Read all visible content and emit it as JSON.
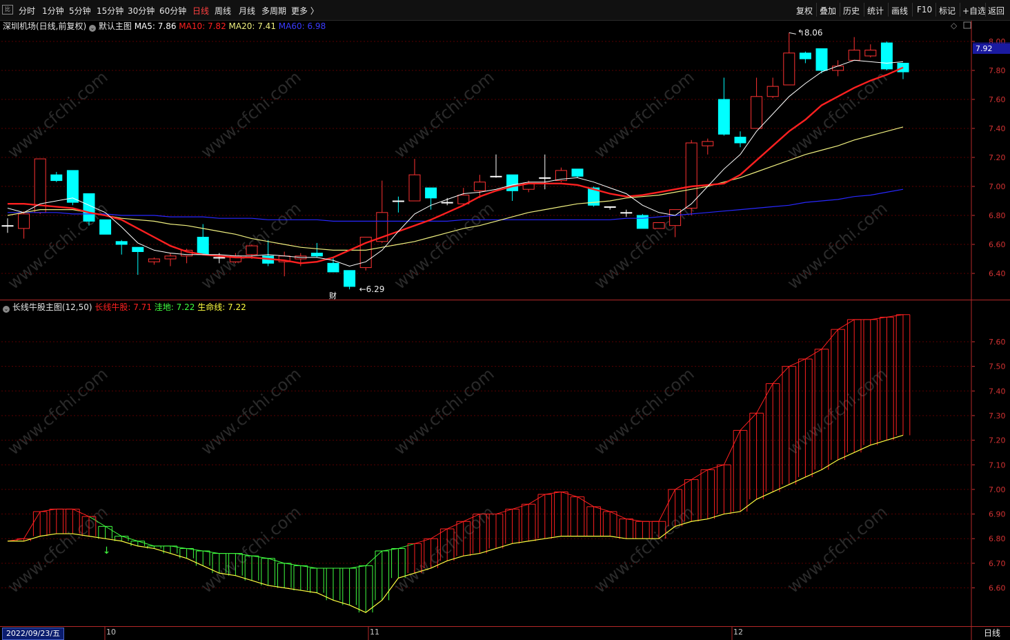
{
  "toolbar": {
    "logo": "比",
    "periods": [
      "分时",
      "1分钟",
      "5分钟",
      "15分钟",
      "30分钟",
      "60分钟",
      "日线",
      "周线",
      "月线",
      "多周期",
      "更多 〉"
    ],
    "active_period": "日线",
    "tools": [
      "复权",
      "叠加",
      "历史",
      "统计",
      "画线",
      "F10",
      "标记",
      "+自选",
      "返回"
    ]
  },
  "main_panel": {
    "stock_title": "深圳机场(日线,前复权)",
    "template_name": "默认主图",
    "ma5": "MA5: 7.86",
    "ma10": "MA10: 7.82",
    "ma20": "MA20: 7.41",
    "ma60": "MA60: 6.98",
    "high_marker": "8.06",
    "low_marker": "6.29",
    "event_marker": "财",
    "current_price": "7.92",
    "price_ticks": [
      "8.00",
      "7.80",
      "7.60",
      "7.40",
      "7.20",
      "7.00",
      "6.80",
      "6.60",
      "6.40"
    ],
    "colors": {
      "up": "#ff3232",
      "down": "#00ffff",
      "ma5": "#ffffff",
      "ma10": "#ff2020",
      "ma20": "#f0f080",
      "ma60": "#2828ff"
    }
  },
  "indicator_panel": {
    "name": "长线牛股主图(12,50)",
    "line1": "长线牛股: 7.71",
    "line2": "洼地: 7.22",
    "line3": "生命线: 7.22",
    "price_ticks": [
      "7.60",
      "7.50",
      "7.40",
      "7.30",
      "7.20",
      "7.10",
      "7.00",
      "6.90",
      "6.80",
      "6.70",
      "6.60"
    ],
    "colors": {
      "bull": "#ff2020",
      "dip": "#40ff40",
      "life": "#ffff40"
    }
  },
  "footer": {
    "date": "2022/09/23/五",
    "months": [
      "10",
      "11",
      "12"
    ],
    "period_label": "日线"
  },
  "watermark": "www.cfchi.com",
  "chart_data": {
    "type": "candlestick",
    "candles": [
      [
        6.73,
        6.73,
        6.78,
        6.68
      ],
      [
        6.71,
        6.81,
        6.83,
        6.64
      ],
      [
        6.82,
        7.19,
        7.19,
        6.81
      ],
      [
        7.08,
        7.04,
        7.1,
        7.03
      ],
      [
        7.11,
        6.89,
        7.11,
        6.87
      ],
      [
        6.95,
        6.76,
        6.95,
        6.73
      ],
      [
        6.77,
        6.67,
        6.77,
        6.67
      ],
      [
        6.62,
        6.6,
        6.63,
        6.53
      ],
      [
        6.58,
        6.55,
        6.58,
        6.39
      ],
      [
        6.48,
        6.5,
        6.51,
        6.46
      ],
      [
        6.5,
        6.52,
        6.54,
        6.45
      ],
      [
        6.52,
        6.56,
        6.57,
        6.47
      ],
      [
        6.65,
        6.53,
        6.74,
        6.53
      ],
      [
        6.51,
        6.51,
        6.54,
        6.47
      ],
      [
        6.48,
        6.52,
        6.54,
        6.47
      ],
      [
        6.53,
        6.59,
        6.6,
        6.5
      ],
      [
        6.52,
        6.47,
        6.63,
        6.45
      ],
      [
        6.48,
        6.52,
        6.55,
        6.38
      ],
      [
        6.5,
        6.52,
        6.54,
        6.45
      ],
      [
        6.54,
        6.52,
        6.61,
        6.51
      ],
      [
        6.47,
        6.41,
        6.51,
        6.41
      ],
      [
        6.42,
        6.31,
        6.42,
        6.29
      ],
      [
        6.44,
        6.65,
        6.65,
        6.42
      ],
      [
        6.62,
        6.82,
        7.04,
        6.61
      ],
      [
        6.9,
        6.89,
        6.93,
        6.82
      ],
      [
        6.9,
        7.08,
        7.19,
        6.9
      ],
      [
        6.99,
        6.92,
        6.99,
        6.84
      ],
      [
        6.88,
        6.89,
        6.92,
        6.87
      ],
      [
        6.88,
        6.94,
        6.99,
        6.87
      ],
      [
        6.97,
        7.03,
        7.08,
        6.92
      ],
      [
        7.07,
        7.07,
        7.22,
        7.06
      ],
      [
        7.08,
        6.97,
        7.08,
        6.9
      ],
      [
        6.98,
        7.02,
        7.04,
        6.96
      ],
      [
        7.05,
        7.06,
        7.22,
        6.98
      ],
      [
        7.04,
        7.11,
        7.13,
        7.03
      ],
      [
        7.12,
        7.07,
        7.12,
        7.06
      ],
      [
        6.99,
        6.87,
        7.0,
        6.86
      ],
      [
        6.86,
        6.86,
        6.86,
        6.84
      ],
      [
        6.82,
        6.82,
        6.84,
        6.79
      ],
      [
        6.8,
        6.71,
        6.81,
        6.71
      ],
      [
        6.71,
        6.75,
        6.75,
        6.71
      ],
      [
        6.73,
        6.84,
        6.84,
        6.65
      ],
      [
        6.85,
        7.3,
        7.32,
        6.8
      ],
      [
        7.28,
        7.31,
        7.33,
        7.22
      ],
      [
        7.6,
        7.36,
        7.75,
        7.35
      ],
      [
        7.34,
        7.3,
        7.38,
        7.27
      ],
      [
        7.4,
        7.62,
        7.75,
        7.4
      ],
      [
        7.62,
        7.69,
        7.75,
        7.61
      ],
      [
        7.7,
        7.92,
        8.06,
        7.7
      ],
      [
        7.92,
        7.88,
        7.93,
        7.85
      ],
      [
        7.95,
        7.8,
        7.95,
        7.78
      ],
      [
        7.8,
        7.83,
        7.87,
        7.76
      ],
      [
        7.87,
        7.94,
        8.03,
        7.87
      ],
      [
        7.9,
        7.94,
        7.98,
        7.89
      ],
      [
        7.99,
        7.81,
        8.0,
        7.8
      ],
      [
        7.85,
        7.79,
        7.85,
        7.74
      ]
    ],
    "ma5": [
      6.85,
      6.82,
      6.88,
      6.9,
      6.92,
      6.87,
      6.82,
      6.72,
      6.61,
      6.56,
      6.54,
      6.53,
      6.53,
      6.53,
      6.52,
      6.52,
      6.53,
      6.52,
      6.51,
      6.51,
      6.49,
      6.45,
      6.48,
      6.56,
      6.69,
      6.81,
      6.87,
      6.91,
      6.95,
      6.96,
      6.98,
      7.01,
      7.03,
      7.03,
      7.05,
      7.06,
      7.03,
      6.99,
      6.95,
      6.87,
      6.82,
      6.8,
      6.88,
      7.0,
      7.12,
      7.22,
      7.38,
      7.5,
      7.62,
      7.71,
      7.79,
      7.83,
      7.87,
      7.86,
      7.85,
      7.86
    ],
    "ma10": [
      6.85,
      6.84,
      6.86,
      6.88,
      6.88,
      6.87,
      6.86,
      6.85,
      6.82,
      6.8,
      6.77,
      6.71,
      6.65,
      6.59,
      6.55,
      6.53,
      6.52,
      6.51,
      6.51,
      6.5,
      6.49,
      6.47,
      6.48,
      6.51,
      6.56,
      6.61,
      6.65,
      6.69,
      6.73,
      6.77,
      6.82,
      6.87,
      6.93,
      6.97,
      7.0,
      7.02,
      7.02,
      7.02,
      7.01,
      6.98,
      6.95,
      6.93,
      6.94,
      6.96,
      6.98,
      7.0,
      7.01,
      7.02,
      7.08,
      7.18,
      7.28,
      7.38,
      7.46,
      7.56,
      7.62,
      7.68,
      7.73,
      7.77,
      7.82
    ],
    "ma20": [
      6.8,
      6.82,
      6.84,
      6.84,
      6.84,
      6.82,
      6.8,
      6.78,
      6.77,
      6.76,
      6.74,
      6.73,
      6.71,
      6.69,
      6.67,
      6.64,
      6.62,
      6.6,
      6.58,
      6.57,
      6.56,
      6.56,
      6.56,
      6.58,
      6.6,
      6.62,
      6.65,
      6.68,
      6.71,
      6.73,
      6.76,
      6.79,
      6.82,
      6.84,
      6.86,
      6.88,
      6.89,
      6.9,
      6.92,
      6.93,
      6.94,
      6.96,
      6.98,
      7.0,
      7.03,
      7.06,
      7.1,
      7.14,
      7.18,
      7.22,
      7.25,
      7.28,
      7.32,
      7.35,
      7.38,
      7.41
    ],
    "ma60": [
      6.82,
      6.82,
      6.82,
      6.82,
      6.81,
      6.81,
      6.81,
      6.8,
      6.8,
      6.8,
      6.79,
      6.79,
      6.79,
      6.78,
      6.78,
      6.78,
      6.77,
      6.77,
      6.77,
      6.77,
      6.76,
      6.76,
      6.76,
      6.76,
      6.76,
      6.76,
      6.76,
      6.76,
      6.77,
      6.77,
      6.77,
      6.77,
      6.77,
      6.77,
      6.77,
      6.77,
      6.77,
      6.77,
      6.78,
      6.78,
      6.79,
      6.8,
      6.81,
      6.82,
      6.83,
      6.84,
      6.85,
      6.86,
      6.87,
      6.89,
      6.9,
      6.91,
      6.93,
      6.94,
      6.96,
      6.98
    ],
    "bull": [
      6.79,
      6.79,
      6.8,
      6.91,
      6.92,
      6.92,
      6.89,
      6.85,
      6.81,
      6.79,
      6.77,
      6.77,
      6.76,
      6.75,
      6.74,
      6.74,
      6.73,
      6.72,
      6.7,
      6.69,
      6.68,
      6.68,
      6.68,
      6.69,
      6.75,
      6.76,
      6.78,
      6.8,
      6.84,
      6.87,
      6.9,
      6.9,
      6.92,
      6.94,
      6.98,
      6.99,
      6.97,
      6.93,
      6.91,
      6.88,
      6.87,
      6.87,
      7.0,
      7.04,
      7.08,
      7.1,
      7.24,
      7.31,
      7.43,
      7.5,
      7.53,
      7.57,
      7.65,
      7.69,
      7.69,
      7.7,
      7.71
    ],
    "dip": [
      6.79,
      6.79,
      6.79,
      6.81,
      6.82,
      6.82,
      6.81,
      6.8,
      6.79,
      6.77,
      6.76,
      6.74,
      6.72,
      6.69,
      6.66,
      6.65,
      6.63,
      6.61,
      6.6,
      6.59,
      6.58,
      6.55,
      6.53,
      6.5,
      6.55,
      6.64,
      6.66,
      6.68,
      6.71,
      6.73,
      6.74,
      6.76,
      6.78,
      6.79,
      6.8,
      6.81,
      6.81,
      6.81,
      6.81,
      6.8,
      6.8,
      6.8,
      6.85,
      6.87,
      6.88,
      6.9,
      6.91,
      6.96,
      6.99,
      7.02,
      7.05,
      7.08,
      7.12,
      7.15,
      7.18,
      7.2,
      7.22
    ]
  }
}
